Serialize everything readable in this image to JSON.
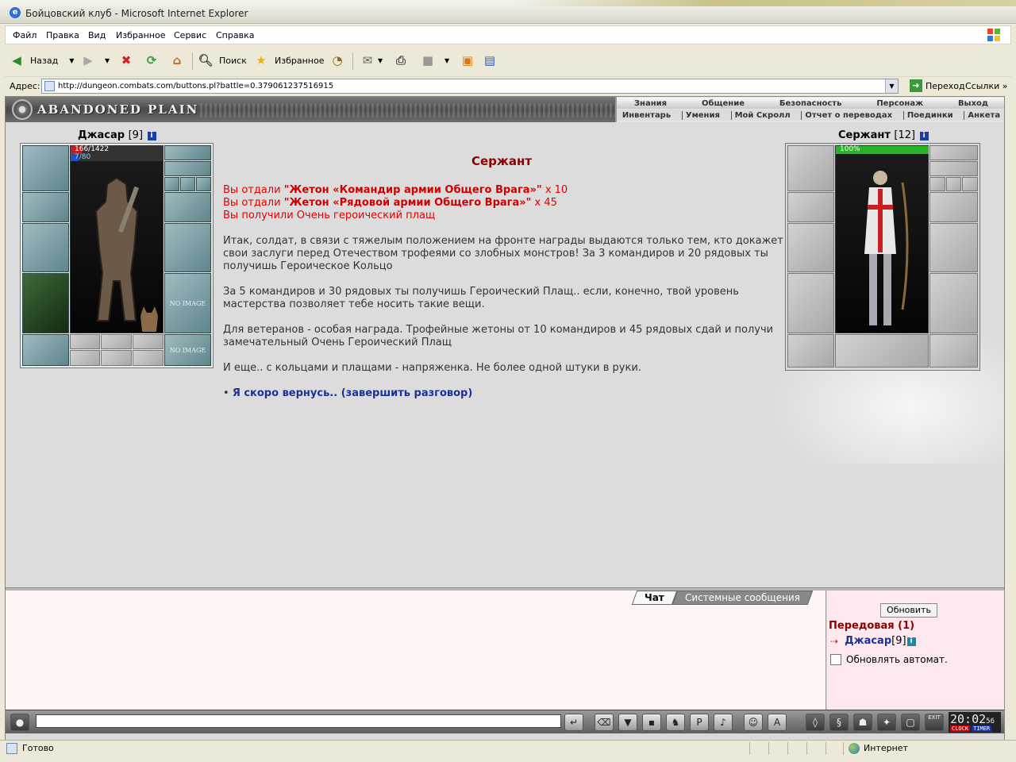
{
  "window": {
    "title": "Бойцовский клуб - Microsoft Internet Explorer"
  },
  "menubar": {
    "items": [
      "Файл",
      "Правка",
      "Вид",
      "Избранное",
      "Сервис",
      "Справка"
    ]
  },
  "toolbar": {
    "back_label": "Назад",
    "search_label": "Поиск",
    "favorites_label": "Избранное"
  },
  "address": {
    "label": "Адрес:",
    "url": "http://dungeon.combats.com/buttons.pl?battle=0.379061237516915",
    "go_label": "Переход",
    "links_label": "Ссылки"
  },
  "game": {
    "logo": "ABANDONED PLAIN",
    "nav_row1": [
      "Знания",
      "Общение",
      "Безопасность",
      "Персонаж",
      "Выход"
    ],
    "nav_row2": [
      "Инвентарь",
      "Умения",
      "Мой Скролл",
      "Отчет о переводах",
      "Поединки",
      "Анкета"
    ],
    "player": {
      "name": "Джасар",
      "level": "[9]",
      "hp": "166/1422",
      "mana": "7/80",
      "hp_fraction": 0.117,
      "mana_fraction": 0.0875,
      "no_image": "NO IMAGE"
    },
    "npc": {
      "name": "Сержант",
      "level": "[12]",
      "hp": "100%",
      "hp_fraction": 1.0
    },
    "dialog": {
      "title": "Сержант",
      "gave1_prefix": "Вы отдали ",
      "gave1_item": "\"Жетон «Командир армии Общего Врага»\"",
      "gave1_suffix": " x 10",
      "gave2_prefix": "Вы отдали ",
      "gave2_item": "\"Жетон «Рядовой армии Общего Врага»\"",
      "gave2_suffix": " x 45",
      "received": "Вы получили Очень героический плащ",
      "para1": "Итак, солдат, в связи с тяжелым положением на фронте награды выдаются только тем, кто докажет свои заслуги перед Отечеством трофеями со злобных монстров! За 3 командиров и 20 рядовых ты получишь Героическое Кольцо",
      "para2": "За 5 командиров и 30 рядовых ты получишь Героический Плащ.. если, конечно, твой уровень мастерства позволяет тебе носить такие вещи.",
      "para3": "Для ветеранов - особая награда. Трофейные жетоны от 10 командиров и 45 рядовых сдай и получи замечательный Очень Героический Плащ",
      "para4": "И еще.. с кольцами и плащами - напряженка. Не более одной штуки в руки.",
      "bullet": "•",
      "exit_link": "Я скоро вернусь.. (завершить разговор)"
    },
    "chat": {
      "tabs": [
        "Чат",
        "Системные сообщения"
      ],
      "refresh_label": "Обновить",
      "room": "Передовая (1)",
      "online_user": "Джасар",
      "online_level": "[9]",
      "auto_refresh": "Обновлять автомат."
    },
    "clock": {
      "time": "20:02",
      "seconds": "56",
      "label1": "CLOCK",
      "label2": "TIMER",
      "exit": "EXIT"
    }
  },
  "statusbar": {
    "text": "Готово",
    "zone": "Интернет"
  }
}
